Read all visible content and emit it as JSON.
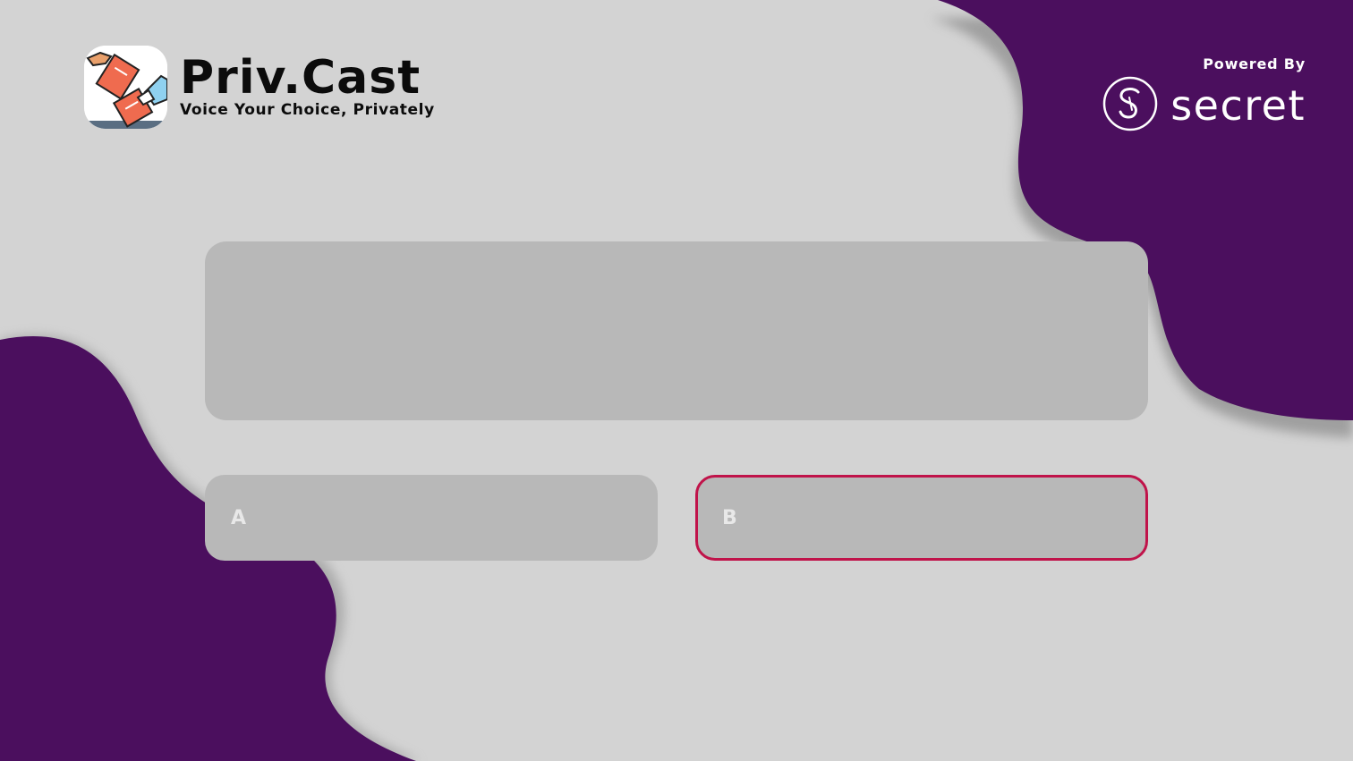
{
  "brand": {
    "title": "Priv.Cast",
    "tagline": "Voice Your Choice, Privately",
    "logo_icon": "ballot-hands-icon"
  },
  "powered": {
    "label": "Powered By",
    "name": "secret",
    "logo_icon": "secret-s-icon"
  },
  "poll": {
    "question": "",
    "options": [
      {
        "label": "A",
        "selected": false
      },
      {
        "label": "B",
        "selected": true
      }
    ]
  },
  "colors": {
    "background": "#d3d3d3",
    "accent_blob": "#4b0f5e",
    "card": "#b8b8b8",
    "selected_border": "#c0134a",
    "option_text": "#e8e8e8"
  }
}
